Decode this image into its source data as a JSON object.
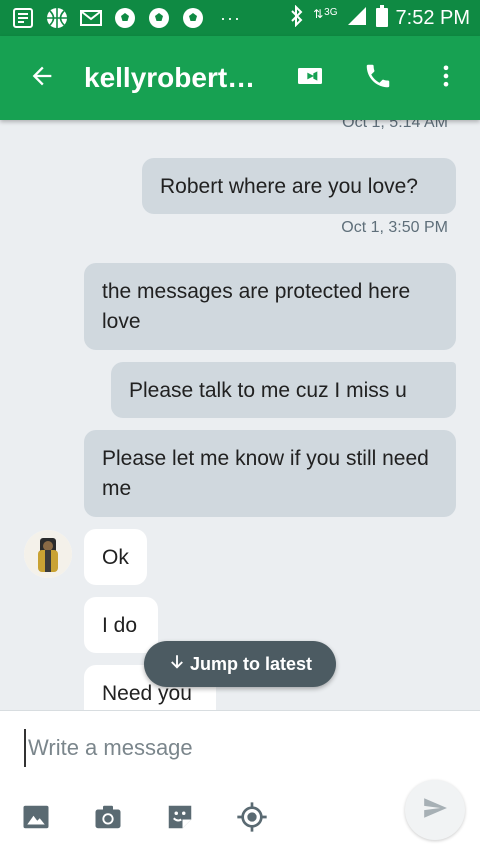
{
  "status_bar": {
    "time": "7:52 PM",
    "network": "3G",
    "overflow": "···",
    "icons": [
      "news-icon",
      "basketball-icon",
      "gmail-icon",
      "soccer-ball-icon",
      "soccer-ball-icon",
      "soccer-ball-icon",
      "bluetooth-icon",
      "signal-icon",
      "battery-icon"
    ]
  },
  "header": {
    "title": "kellyrobert…",
    "icons": [
      "back-arrow-icon",
      "video-call-icon",
      "phone-icon",
      "more-vert-icon"
    ]
  },
  "conversation": {
    "partial_timestamp": "Oct 1, 5:14 AM",
    "messages": [
      {
        "text": "Robert where are you love?",
        "direction": "outgoing"
      },
      {
        "timestamp": "Oct 1, 3:50 PM"
      },
      {
        "text": "the messages are protected here love",
        "direction": "outgoing"
      },
      {
        "text": "Please talk to me cuz I miss u",
        "direction": "outgoing"
      },
      {
        "text": "Please let me know if you still need me",
        "direction": "outgoing"
      },
      {
        "text": "Ok",
        "direction": "incoming"
      },
      {
        "text": "I do",
        "direction": "incoming"
      },
      {
        "text": "Need you",
        "direction": "incoming"
      }
    ],
    "jump_label": "Jump to latest"
  },
  "compose": {
    "placeholder": "Write a message",
    "tools": [
      "image-icon",
      "camera-icon",
      "sticker-icon",
      "location-icon"
    ],
    "send_icon": "send-icon"
  },
  "colors": {
    "status_bar": "#0f8a43",
    "app_bar": "#17a152",
    "chat_bg": "#ebeef1",
    "outgoing_bubble": "#d0d8de",
    "incoming_bubble": "#ffffff",
    "jump_pill": "#4c5b62"
  }
}
